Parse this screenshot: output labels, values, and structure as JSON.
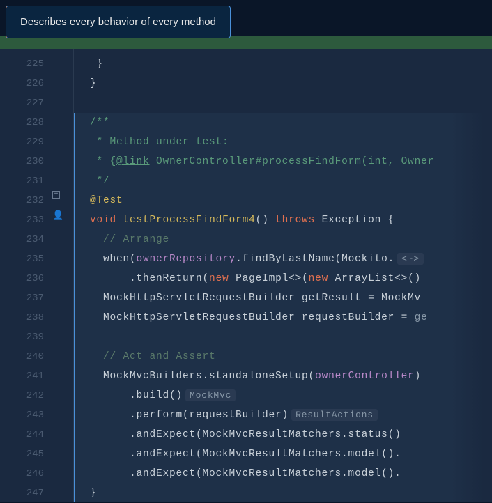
{
  "tooltip": "Describes every behavior of every method",
  "lines": {
    "l225": {
      "num": "225",
      "indent": "   ",
      "brace": "}"
    },
    "l226": {
      "num": "226",
      "indent": "  ",
      "brace": "}"
    },
    "l227": {
      "num": "227"
    },
    "l228": {
      "num": "228",
      "indent": "  ",
      "doc": "/**"
    },
    "l229": {
      "num": "229",
      "indent": "  ",
      "doc": " * Method under test:"
    },
    "l230": {
      "num": "230",
      "indent": "  ",
      "doc_pre": " * {",
      "link": "@link",
      "doc_post": " OwnerController#processFindForm(int, Owner"
    },
    "l231": {
      "num": "231",
      "indent": "  ",
      "doc": " */"
    },
    "l232": {
      "num": "232",
      "indent": "  ",
      "anno": "@Test"
    },
    "l233": {
      "num": "233",
      "indent": "  ",
      "kw1": "void",
      "space1": " ",
      "m": "testProcessFindForm4",
      "parens": "() ",
      "kw2": "throws",
      "space2": " ",
      "t": "Exception {"
    },
    "l234": {
      "num": "234",
      "indent": "    ",
      "comment": "// Arrange"
    },
    "l235": {
      "num": "235",
      "indent": "    ",
      "t1": "when(",
      "f": "ownerRepository",
      "t2": ".findByLastName(Mockito.",
      "hint": "<~>"
    },
    "l236": {
      "num": "236",
      "indent": "        ",
      "t1": ".thenReturn(",
      "kw1": "new",
      "sp1": " ",
      "t2": "PageImpl<>(",
      "kw2": "new",
      "sp2": " ",
      "t3": "ArrayList<>()"
    },
    "l237": {
      "num": "237",
      "indent": "    ",
      "t": "MockHttpServletRequestBuilder getResult = MockMv"
    },
    "l238": {
      "num": "238",
      "indent": "    ",
      "t1": "MockHttpServletRequestBuilder requestBuilder = ",
      "p": "ge"
    },
    "l239": {
      "num": "239"
    },
    "l240": {
      "num": "240",
      "indent": "    ",
      "comment": "// Act and Assert"
    },
    "l241": {
      "num": "241",
      "indent": "    ",
      "t1": "MockMvcBuilders.standaloneSetup(",
      "f": "ownerController",
      "t2": ")"
    },
    "l242": {
      "num": "242",
      "indent": "        ",
      "t": ".build()",
      "hint": "MockMvc"
    },
    "l243": {
      "num": "243",
      "indent": "        ",
      "t": ".perform(requestBuilder)",
      "hint": "ResultActions"
    },
    "l244": {
      "num": "244",
      "indent": "        ",
      "t": ".andExpect(MockMvcResultMatchers.status()"
    },
    "l245": {
      "num": "245",
      "indent": "        ",
      "t": ".andExpect(MockMvcResultMatchers.model()."
    },
    "l246": {
      "num": "246",
      "indent": "        ",
      "t": ".andExpect(MockMvcResultMatchers.model()."
    },
    "l247": {
      "num": "247",
      "indent": "  ",
      "brace": "}"
    }
  }
}
